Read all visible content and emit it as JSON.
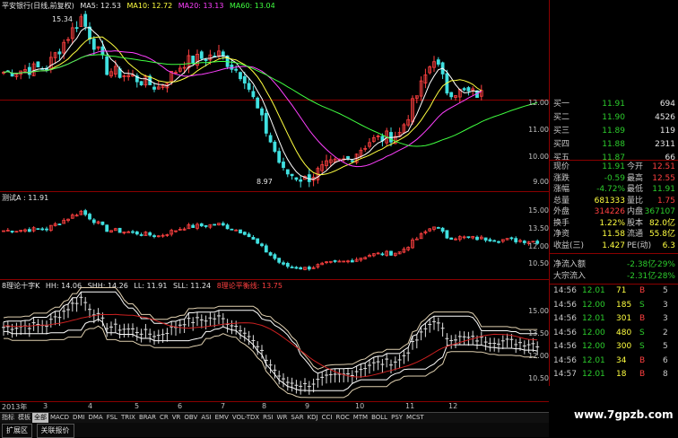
{
  "panel1": {
    "title": "平安银行(日线,前复权)",
    "ma5": "MA5: 12.53",
    "ma10": "MA10: 12.72",
    "ma20": "MA20: 13.13",
    "ma60": "MA60: 13.04",
    "high_label": "15.34",
    "low_label": "8.97",
    "yticks": [
      "12.00",
      "11.00",
      "10.00",
      "9.00"
    ]
  },
  "panel2": {
    "title": "测试A : 11.91",
    "yticks": [
      "15.00",
      "13.50",
      "12.00",
      "10.50"
    ]
  },
  "panel3": {
    "title": "8理论十字K",
    "hh": "HH: 14.06",
    "shh": "SHH: 14.26",
    "ll": "LL: 11.91",
    "sll": "SLL: 11.24",
    "balance": "8理论平衡线: 13.75",
    "yticks": [
      "15.00",
      "13.50",
      "12.00",
      "10.50"
    ]
  },
  "xaxis": {
    "labels": [
      "2013年",
      "3",
      "4",
      "5",
      "6",
      "7",
      "8",
      "9",
      "10",
      "11",
      "12"
    ]
  },
  "quote": {
    "bids": [
      {
        "label": "买一",
        "price": "11.91",
        "vol": "694"
      },
      {
        "label": "买二",
        "price": "11.90",
        "vol": "4526"
      },
      {
        "label": "买三",
        "price": "11.89",
        "vol": "119"
      },
      {
        "label": "买四",
        "price": "11.88",
        "vol": "2311"
      },
      {
        "label": "买五",
        "price": "11.87",
        "vol": "66"
      }
    ],
    "stats": [
      {
        "l": "现价",
        "v": "11.91",
        "l2": "今开",
        "v2": "12.51"
      },
      {
        "l": "涨跌",
        "v": "-0.59",
        "l2": "最高",
        "v2": "12.55"
      },
      {
        "l": "涨幅",
        "v": "-4.72%",
        "l2": "最低",
        "v2": "11.91"
      },
      {
        "l": "总量",
        "v": "681333",
        "l2": "量比",
        "v2": "1.75"
      },
      {
        "l": "外盘",
        "v": "314226",
        "l2": "内盘",
        "v2": "367107"
      },
      {
        "l": "换手",
        "v": "1.22%",
        "l2": "股本",
        "v2": "82.0亿"
      },
      {
        "l": "净资",
        "v": "11.58",
        "l2": "流通",
        "v2": "55.8亿"
      },
      {
        "l": "收益(三)",
        "v": "1.427",
        "l2": "PE(动)",
        "v2": "6.3"
      }
    ],
    "flow": [
      {
        "l": "净流入额",
        "v": "-2.38亿",
        "p": "-29%"
      },
      {
        "l": "大宗流入",
        "v": "-2.31亿",
        "p": "-28%"
      }
    ],
    "ticks": [
      {
        "t": "14:56",
        "p": "12.01",
        "v": "71",
        "s": "B",
        "n": "5"
      },
      {
        "t": "14:56",
        "p": "12.00",
        "v": "185",
        "s": "S",
        "n": "3"
      },
      {
        "t": "14:56",
        "p": "12.01",
        "v": "301",
        "s": "B",
        "n": "3"
      },
      {
        "t": "14:56",
        "p": "12.00",
        "v": "480",
        "s": "S",
        "n": "2"
      },
      {
        "t": "14:56",
        "p": "12.00",
        "v": "300",
        "s": "S",
        "n": "5"
      },
      {
        "t": "14:56",
        "p": "12.01",
        "v": "34",
        "s": "B",
        "n": "6"
      },
      {
        "t": "14:57",
        "p": "12.01",
        "v": "18",
        "s": "B",
        "n": "8"
      }
    ]
  },
  "tabs": [
    "指标",
    "模板",
    "全部",
    "MACD",
    "DMI",
    "DMA",
    "FSL",
    "TRIX",
    "BRAR",
    "CR",
    "VR",
    "OBV",
    "ASI",
    "EMV",
    "VOL-TDX",
    "RSI",
    "WR",
    "SAR",
    "KDJ",
    "CCI",
    "ROC",
    "MTM",
    "BOLL",
    "PSY",
    "MCST"
  ],
  "bottom": [
    "扩展区",
    "关联报价"
  ],
  "watermark": "www.7gpzb.com",
  "colors": {
    "up": "#ff4040",
    "down": "#40e0e0",
    "ma5": "#ffffff",
    "ma10": "#ffff40",
    "ma20": "#ff40ff",
    "ma60": "#40ff40",
    "border": "#8b0000"
  }
}
